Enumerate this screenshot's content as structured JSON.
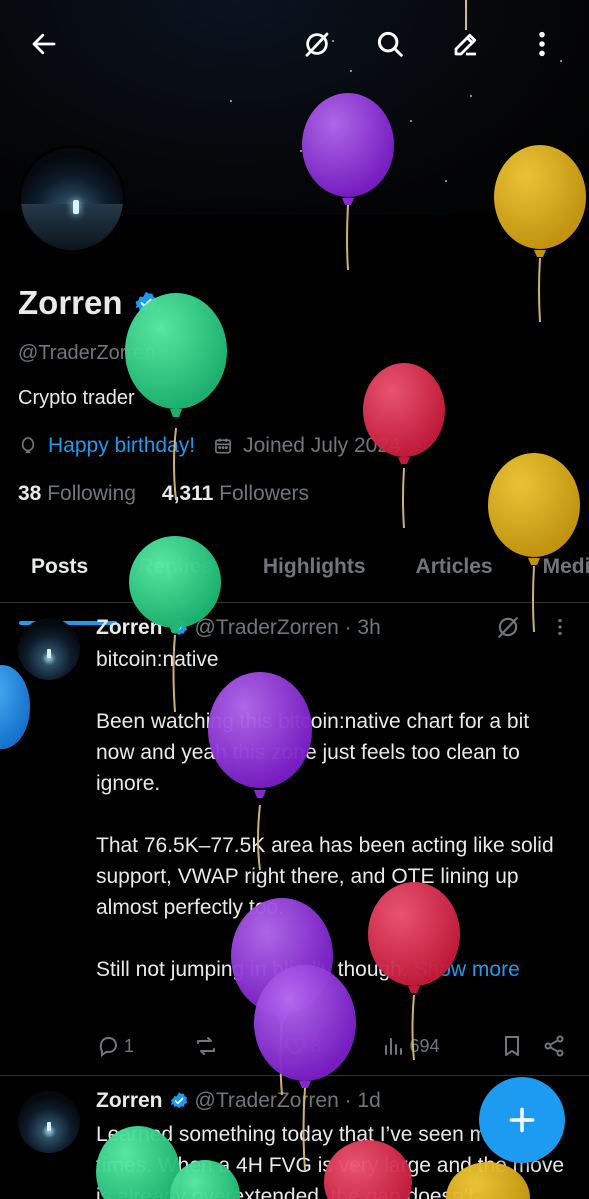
{
  "profile": {
    "name": "Zorren",
    "handle": "@TraderZorren",
    "bio": "Crypto trader",
    "birthday_text": "Happy birthday!",
    "joined_text": "Joined July 2024",
    "following_count": "38",
    "following_label": "Following",
    "followers_count": "4,311",
    "followers_label": "Followers"
  },
  "tabs": [
    "Posts",
    "Replies",
    "Highlights",
    "Articles",
    "Media"
  ],
  "posts": [
    {
      "name": "Zorren",
      "handle_time": "@TraderZorren · 3h",
      "paragraphs": [
        "bitcoin:native",
        "Been watching this bitcoin:native  chart for a bit now and yeah this zone just feels too clean to ignore.",
        "That 76.5K–77.5K area has been acting like solid support, VWAP right there, and OTE lining up almost perfectly too.",
        "Still not jumping in blindly though."
      ],
      "show_more": "Show more",
      "replies": "1",
      "reposts": "",
      "likes": "8",
      "views": "694"
    },
    {
      "name": "Zorren",
      "handle_time": "@TraderZorren · 1d",
      "text": "Learned something today that I’ve seen many times. When a 4H FVG is very large and the move is already overextended, the gap doesn’t"
    }
  ],
  "icons": {
    "back": "arrow-left-icon",
    "grok": "grok-icon",
    "search": "search-icon",
    "edit": "edit-icon",
    "more": "more-vertical-icon",
    "compose": "plus-icon"
  },
  "colors": {
    "accent": "#1d9bf0",
    "muted": "#71767b",
    "text": "#e7e9ea",
    "border": "#2f3336"
  }
}
